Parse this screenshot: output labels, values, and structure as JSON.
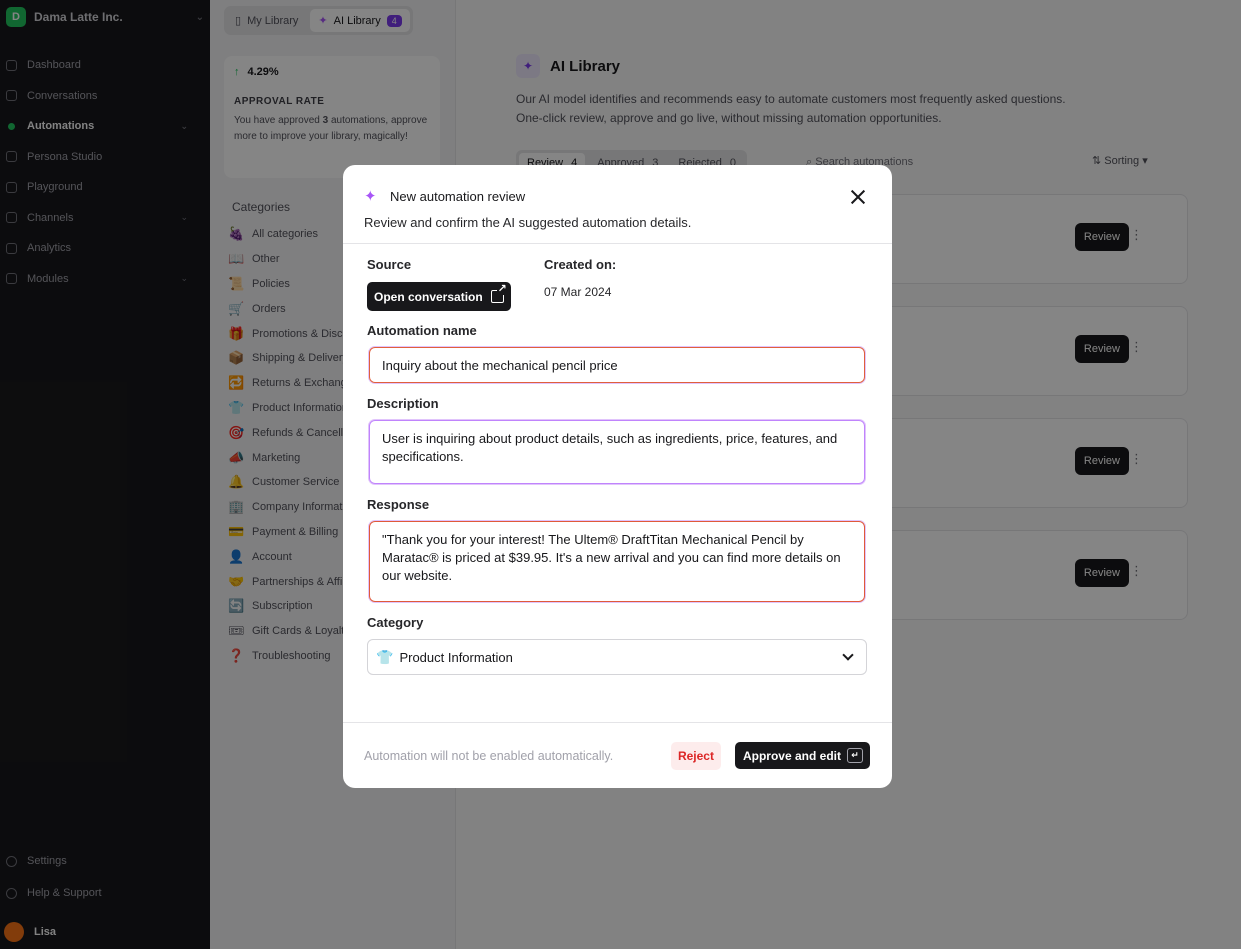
{
  "app": {
    "workspace_name": "Dama Latte Inc.",
    "brand_initial": "D"
  },
  "sidebar": {
    "items": [
      {
        "label": "Dashboard",
        "icon": "dashboard-icon"
      },
      {
        "label": "Conversations",
        "icon": "conversations-icon"
      },
      {
        "label": "Automations",
        "icon": "automations-icon",
        "active": true
      },
      {
        "label": "Persona Studio",
        "icon": "persona-icon"
      },
      {
        "label": "Playground",
        "icon": "playground-icon"
      },
      {
        "label": "Channels",
        "icon": "channels-icon"
      },
      {
        "label": "Analytics",
        "icon": "analytics-icon"
      },
      {
        "label": "Modules",
        "icon": "modules-icon"
      }
    ],
    "bottom": [
      {
        "label": "Settings",
        "icon": "gear-icon"
      },
      {
        "label": "Help & Support",
        "icon": "help-icon"
      }
    ],
    "user_name": "Lisa"
  },
  "library_tabs": {
    "my_library": "My Library",
    "ai_library": "AI Library",
    "ai_badge": "4"
  },
  "stat_card": {
    "value": "4.29%",
    "title": "APPROVAL RATE",
    "text_prefix": "You have approved",
    "approved_count": "3",
    "text_suffix": "automations, approve more to improve your library, magically!"
  },
  "categories": {
    "title": "Categories",
    "items": [
      {
        "emoji": "🍇",
        "label": "All categories"
      },
      {
        "emoji": "📖",
        "label": "Other"
      },
      {
        "emoji": "📜",
        "label": "Policies"
      },
      {
        "emoji": "🛒",
        "label": "Orders"
      },
      {
        "emoji": "🎁",
        "label": "Promotions & Discounts"
      },
      {
        "emoji": "📦",
        "label": "Shipping & Delivery"
      },
      {
        "emoji": "🔁",
        "label": "Returns & Exchanges"
      },
      {
        "emoji": "👕",
        "label": "Product Information"
      },
      {
        "emoji": "🎯",
        "label": "Refunds & Cancellations"
      },
      {
        "emoji": "📣",
        "label": "Marketing"
      },
      {
        "emoji": "🔔",
        "label": "Customer Service"
      },
      {
        "emoji": "🏢",
        "label": "Company Information"
      },
      {
        "emoji": "💳",
        "label": "Payment & Billing"
      },
      {
        "emoji": "👤",
        "label": "Account"
      },
      {
        "emoji": "🤝",
        "label": "Partnerships & Affiliates"
      },
      {
        "emoji": "🔄",
        "label": "Subscription"
      },
      {
        "emoji": "🎟",
        "label": "Gift Cards & Loyalty"
      },
      {
        "emoji": "❓",
        "label": "Troubleshooting"
      }
    ]
  },
  "main": {
    "title": "AI Library",
    "description": "Our AI model identifies and recommends easy to automate customers most frequently asked questions. One-click review, approve and go live, without missing automation opportunities.",
    "filters": [
      {
        "label": "Review",
        "count": "4"
      },
      {
        "label": "Approved",
        "count": "3"
      },
      {
        "label": "Rejected",
        "count": "0"
      }
    ],
    "search_placeholder": "Search automations",
    "sort_label": "Sorting",
    "row_button": "Review"
  },
  "modal": {
    "title": "New automation review",
    "subtitle": "Review and confirm the AI suggested automation details.",
    "source_label": "Source",
    "open_conversation": "Open conversation",
    "created_label": "Created on:",
    "created_value": "07 Mar 2024",
    "name_label": "Automation name",
    "name_value": "Inquiry about the mechanical pencil price",
    "description_label": "Description",
    "description_value": "User is inquiring about product details, such as ingredients, price, features, and specifications.",
    "response_label": "Response",
    "response_value": "\"Thank you for your interest! The Ultem® DraftTitan Mechanical Pencil by Maratac® is priced at $39.95. It's a new arrival and you can find more details on our website.",
    "category_label": "Category",
    "category_emoji": "👕",
    "category_value": "Product Information",
    "footer_note": "Automation will not be enabled automatically.",
    "reject_label": "Reject",
    "approve_label": "Approve and edit",
    "enter_key": "↵"
  }
}
